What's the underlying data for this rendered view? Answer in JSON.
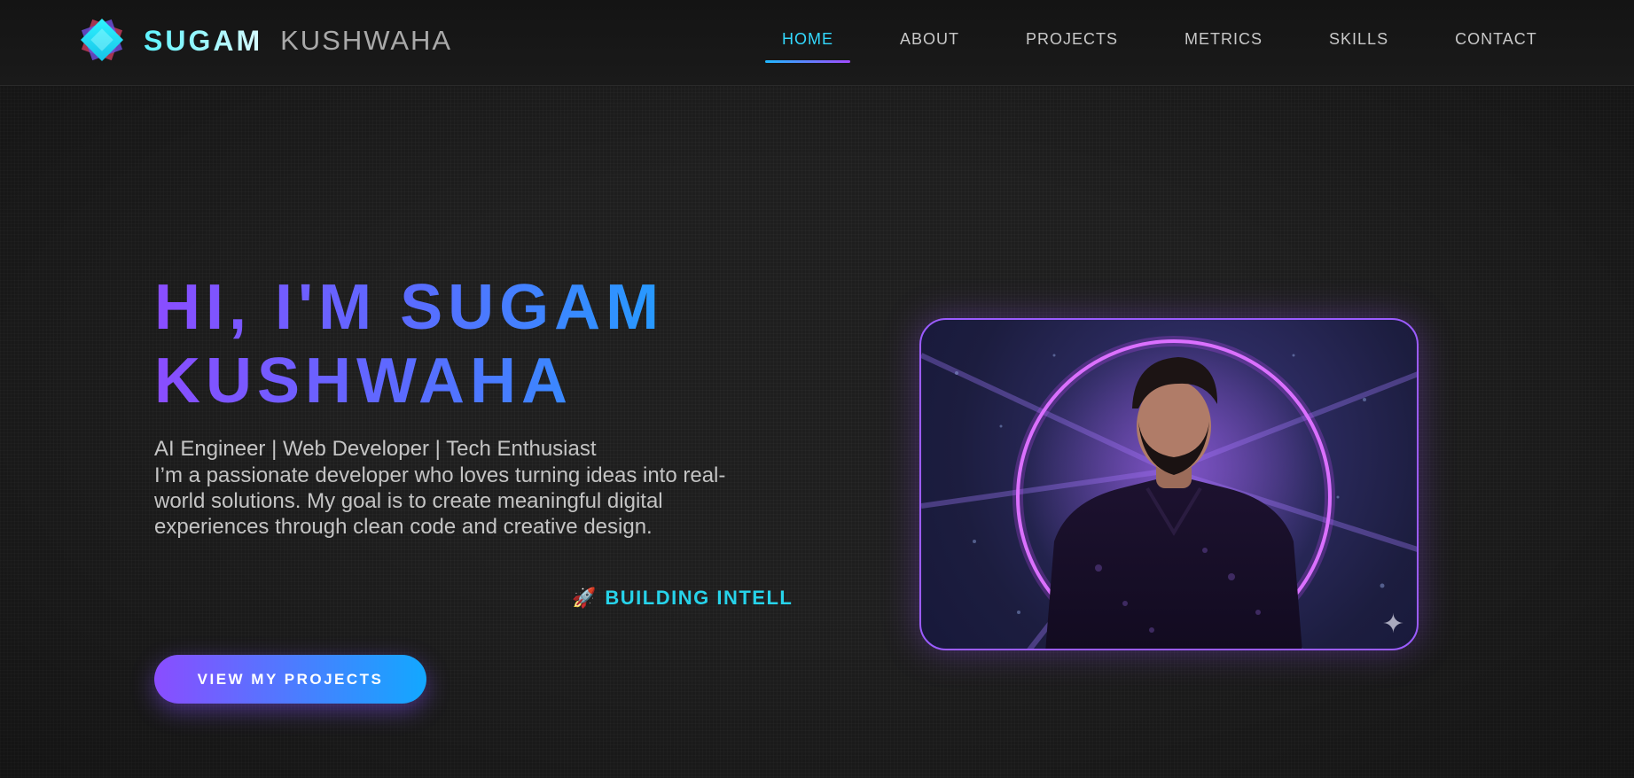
{
  "brand": {
    "first": "SUGAM",
    "last": "KUSHWAHA",
    "logo_icon": "diamond-logo-icon"
  },
  "nav": {
    "items": [
      {
        "label": "HOME",
        "active": true
      },
      {
        "label": "ABOUT",
        "active": false
      },
      {
        "label": "PROJECTS",
        "active": false
      },
      {
        "label": "METRICS",
        "active": false
      },
      {
        "label": "SKILLS",
        "active": false
      },
      {
        "label": "CONTACT",
        "active": false
      }
    ]
  },
  "hero": {
    "headline_line1": "HI, I'M SUGAM",
    "headline_line2": "KUSHWAHA",
    "tagline": "AI Engineer | Web Developer | Tech Enthusiast",
    "intro": "I’m a passionate developer who loves turning ideas into real-world solutions. My goal is to create meaningful digital experiences through clean code and creative design.",
    "typing_icon": "🚀",
    "typing_text": "BUILDING INTELL",
    "cta_label": "VIEW MY PROJECTS"
  },
  "portrait": {
    "sparkle_icon": "✦"
  },
  "colors": {
    "background": "#1e1e1e",
    "accent_cyan": "#27d3ea",
    "accent_purple": "#8a4dff",
    "accent_blue": "#12a8ff",
    "nav_active": "#33d9ff"
  }
}
